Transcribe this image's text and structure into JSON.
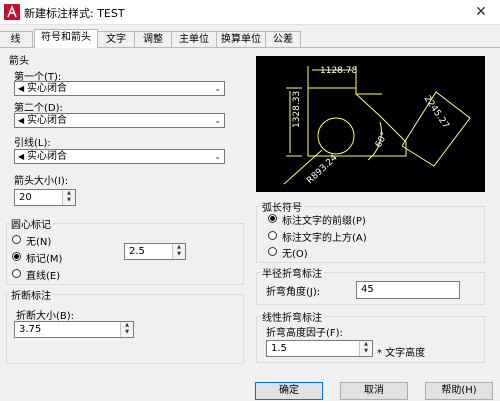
{
  "window": {
    "title": "新建标注样式: TEST",
    "close_glyph": "✕"
  },
  "tabs": [
    {
      "label": "线",
      "active": false
    },
    {
      "label": "符号和箭头",
      "active": true
    },
    {
      "label": "文字",
      "active": false
    },
    {
      "label": "调整",
      "active": false
    },
    {
      "label": "主单位",
      "active": false
    },
    {
      "label": "换算单位",
      "active": false
    },
    {
      "label": "公差",
      "active": false
    }
  ],
  "arrowheads": {
    "title": "箭头",
    "first_label": "第一个(T):",
    "first_value": "实心闭合",
    "second_label": "第二个(D):",
    "second_value": "实心闭合",
    "leader_label": "引线(L):",
    "leader_value": "实心闭合",
    "size_label": "箭头大小(I):",
    "size_value": "20"
  },
  "center_marks": {
    "title": "圆心标记",
    "options": [
      {
        "label": "无(N)",
        "checked": false
      },
      {
        "label": "标记(M)",
        "checked": true
      },
      {
        "label": "直线(E)",
        "checked": false
      }
    ],
    "size_value": "2.5"
  },
  "break": {
    "title": "折断标注",
    "size_label": "折断大小(B):",
    "size_value": "3.75"
  },
  "preview": {
    "dim_top": "1128.78",
    "dim_left": "1328.33",
    "dim_aligned": "2245.27",
    "dim_angle": "60°",
    "dim_radius": "R893.24",
    "line_color": "#ffff66",
    "text_color": "#ffffff"
  },
  "arc_length": {
    "title": "弧长符号",
    "options": [
      {
        "label": "标注文字的前缀(P)",
        "checked": true
      },
      {
        "label": "标注文字的上方(A)",
        "checked": false
      },
      {
        "label": "无(O)",
        "checked": false
      }
    ]
  },
  "radius_jog": {
    "title": "半径折弯标注",
    "angle_label": "折弯角度(J):",
    "angle_value": "45"
  },
  "linear_jog": {
    "title": "线性折弯标注",
    "factor_label": "折弯高度因子(F):",
    "factor_value": "1.5",
    "suffix": "* 文字高度"
  },
  "buttons": {
    "ok": "确定",
    "cancel": "取消",
    "help": "帮助(H)"
  }
}
